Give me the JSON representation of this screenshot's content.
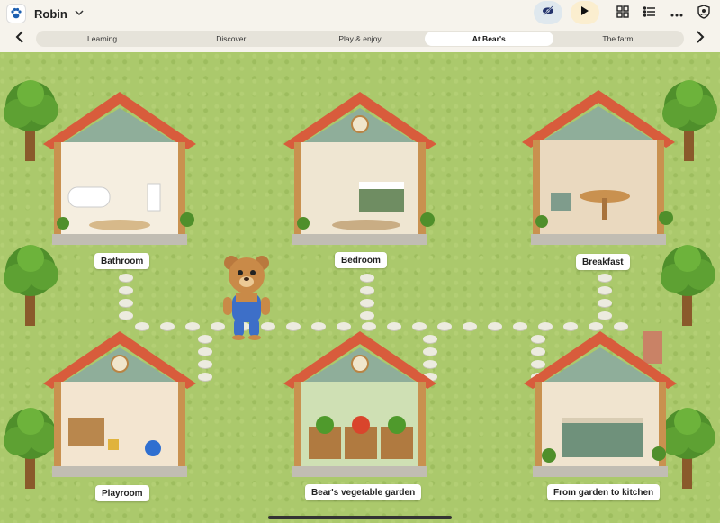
{
  "header": {
    "profile_name": "Robin",
    "icons": [
      "paw-icon",
      "chevron-down-icon",
      "eye-slash-icon",
      "play-icon",
      "grid-icon",
      "list-icon",
      "more-icon",
      "shield-icon"
    ]
  },
  "tabs": [
    {
      "label": "Learning",
      "active": false
    },
    {
      "label": "Discover",
      "active": false
    },
    {
      "label": "Play & enjoy",
      "active": false
    },
    {
      "label": "At Bear's",
      "active": true
    },
    {
      "label": "The farm",
      "active": false
    }
  ],
  "rooms": [
    {
      "label": "Bathroom"
    },
    {
      "label": "Bedroom"
    },
    {
      "label": "Breakfast"
    },
    {
      "label": "Playroom"
    },
    {
      "label": "Bear's vegetable garden"
    },
    {
      "label": "From garden to kitchen"
    }
  ],
  "colors": {
    "accent_pink": "#e8e3f5",
    "accent_yellow": "#fbeecf",
    "grass": "#abc96c",
    "roof": "#d85c3c"
  }
}
